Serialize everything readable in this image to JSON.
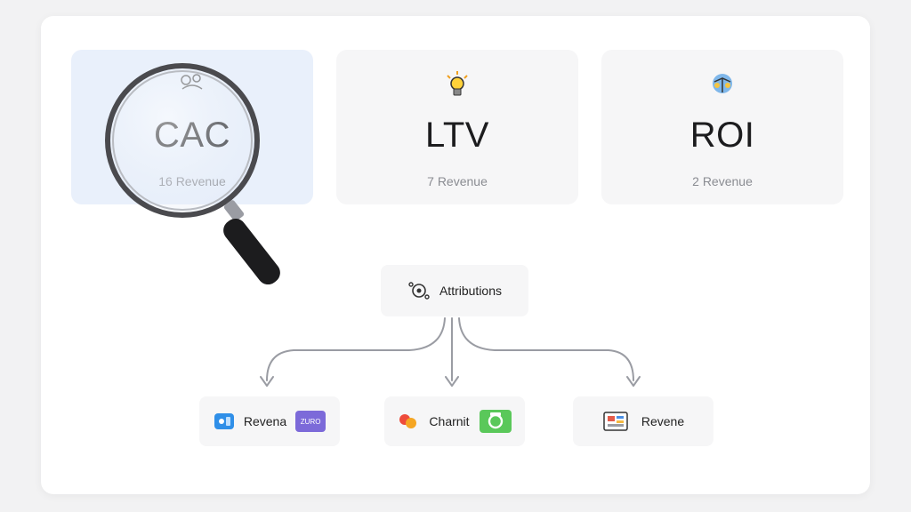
{
  "cards": [
    {
      "title": "CAC",
      "subtitle": "16 Revenue",
      "icon": "network-icon"
    },
    {
      "title": "LTV",
      "subtitle": "7 Revenue",
      "icon": "lightbulb-icon"
    },
    {
      "title": "ROI",
      "subtitle": "2 Revenue",
      "icon": "scales-icon"
    }
  ],
  "attribution": {
    "label": "Attributions",
    "icon": "gear-network-icon"
  },
  "leaves": [
    {
      "label": "Revena",
      "icon": "blue-app-icon",
      "badge": "ZURO"
    },
    {
      "label": "Charnit",
      "icon": "red-orange-dots-icon",
      "badge_icon": "green-camera-icon"
    },
    {
      "label": "Revene",
      "icon": "dashboard-icon"
    }
  ],
  "colors": {
    "highlight": "#e9f0fb",
    "card": "#f6f6f7",
    "arrow": "#9a9ca3"
  }
}
